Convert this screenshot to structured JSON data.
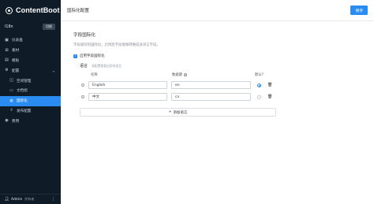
{
  "brand": {
    "name": "ContentBoot"
  },
  "workspace": {
    "name": "I18n",
    "switch_label": "切换"
  },
  "nav": [
    {
      "label": "仪表盘",
      "icon": "dashboard-icon",
      "glyph": "▣"
    },
    {
      "label": "素材",
      "icon": "assets-icon",
      "glyph": "⊞"
    },
    {
      "label": "模板",
      "icon": "template-icon",
      "glyph": "▤"
    },
    {
      "label": "配置",
      "icon": "settings-icon",
      "glyph": "⚙",
      "expanded": true
    },
    {
      "label": "空间管理",
      "icon": "space-icon",
      "glyph": "◫",
      "sub": true
    },
    {
      "label": "文档组",
      "icon": "doc-group-icon",
      "glyph": "▭",
      "sub": true
    },
    {
      "label": "国际化",
      "icon": "globe-icon",
      "glyph": "◍",
      "sub": true,
      "active": true
    },
    {
      "label": "发布配置",
      "icon": "publish-icon",
      "glyph": "⇪",
      "sub": true
    },
    {
      "label": "费用",
      "icon": "billing-icon",
      "glyph": "◉"
    }
  ],
  "user": {
    "name": "Admin",
    "role": "所有者"
  },
  "header": {
    "title": "国际化配置",
    "save_label": "保存"
  },
  "section": {
    "title": "字段国际化",
    "desc": "字段级别的国际化，启用后字段能够转换成多语言字段。",
    "enable_label": "启用字段国际化",
    "enabled": true
  },
  "languages": {
    "label": "语言",
    "hint": "请配置需要启用的语言",
    "col_name": "名称",
    "col_key": "数据键",
    "col_default": "默认?",
    "rows": [
      {
        "name": "English",
        "key": "en",
        "default": true
      },
      {
        "name": "中文",
        "key": "cn",
        "default": false
      }
    ],
    "add_label": "添加语言"
  },
  "colors": {
    "accent": "#2a8cf0",
    "sidebar_bg": "#0f1b27"
  }
}
